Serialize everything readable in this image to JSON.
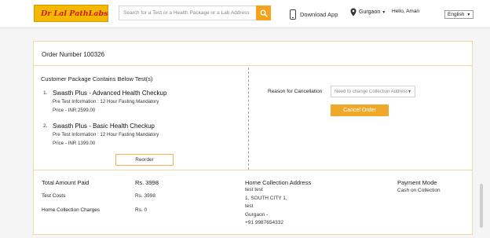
{
  "header": {
    "logo_text": "Dr Lal PathLabs",
    "search_placeholder": "Search for a Test or a Health Package or a Lab Address",
    "download_label": "Download App",
    "city": "Gurgaon",
    "greeting": "Hello, Aman",
    "language": "English"
  },
  "order": {
    "number_label": "Order Number 100326"
  },
  "package": {
    "title": "Customer Package Contains Below Test(s)",
    "tests": [
      {
        "num": "1.",
        "name": "Swasth Plus - Advanced Health Checkup",
        "info": "Pre Test Information : 12 Hour Fasting Mandatory",
        "price": "Price - INR 2599.00"
      },
      {
        "num": "2.",
        "name": "Swasth Plus - Basic Health Checkup",
        "info": "Pre Test Information : 12 Hour Fasting Mandatory",
        "price": "Price - INR 1399.00"
      }
    ],
    "reorder_label": "Reorder"
  },
  "cancellation": {
    "reason_label": "Reason for Cancellation",
    "reason_value": "Need to change Collection Address",
    "cancel_label": "Cancel Order"
  },
  "summary": {
    "total_label": "Total Amount Paid",
    "total_value": "Rs. 3998",
    "test_costs_label": "Test Costs",
    "test_costs_value": "Rs. 3998",
    "collection_label": "Home Collection Charges",
    "collection_value": "Rs. 0",
    "address_title": "Home Collection Address",
    "address_lines": [
      "test test",
      "1, SOUTH CITY 1,",
      "test",
      "Gurgaon -",
      "+91 9987654332"
    ],
    "payment_title": "Payment Mode",
    "payment_value": "Cash on Collection"
  },
  "colors": {
    "brand_yellow": "#f5b800",
    "brand_red": "#c81d25",
    "accent_orange": "#f0a82b",
    "card_border": "#f0d9a8"
  }
}
